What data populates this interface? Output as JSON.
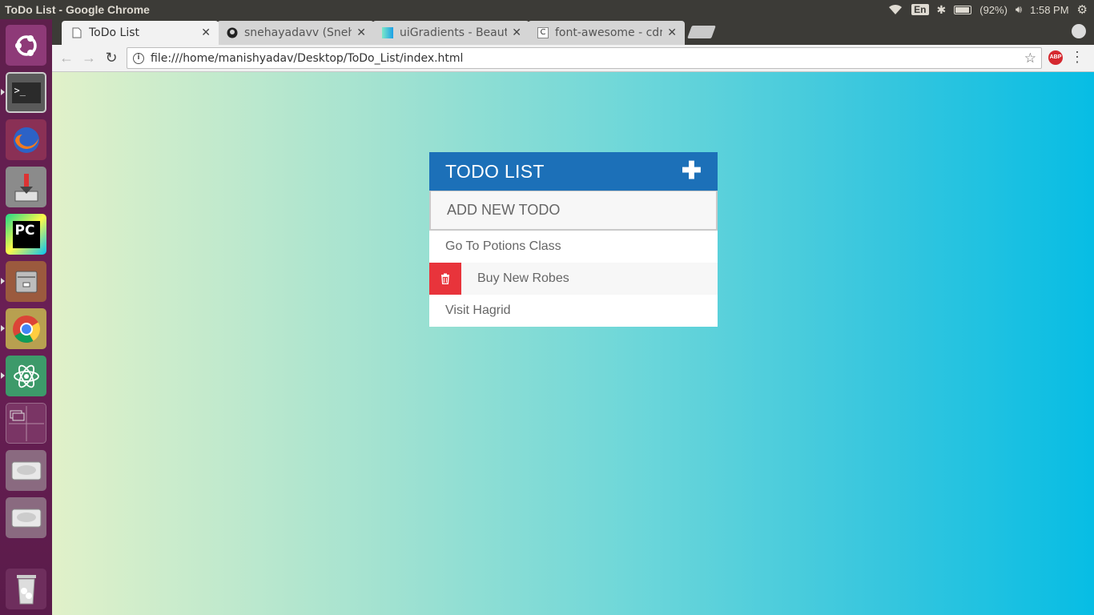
{
  "system_panel": {
    "window_title": "ToDo List - Google Chrome",
    "keyboard_layout": "En",
    "battery": "(92%)",
    "time": "1:58 PM"
  },
  "launcher": {
    "items": [
      "ubuntu-dash-icon",
      "terminal-icon",
      "firefox-icon",
      "installer-icon",
      "pycharm-icon",
      "file-manager-icon",
      "chrome-icon",
      "atom-icon",
      "workspace-switcher-icon",
      "drive-icon",
      "drive-icon",
      "trash-icon"
    ]
  },
  "browser": {
    "tabs": [
      {
        "title": "ToDo List",
        "active": true
      },
      {
        "title": "snehayadavv (Sneh",
        "active": false
      },
      {
        "title": "uiGradients - Beaut",
        "active": false
      },
      {
        "title": "font-awesome - cdn",
        "active": false
      }
    ],
    "url": "file:///home/manishyadav/Desktop/ToDo_List/index.html",
    "extension_badge": "ABP"
  },
  "app": {
    "title": "TODO LIST",
    "add_placeholder": "ADD NEW TODO",
    "todos": [
      {
        "text": "Go To Potions Class",
        "hovered": false
      },
      {
        "text": "Buy New Robes",
        "hovered": true
      },
      {
        "text": "Visit Hagrid",
        "hovered": false
      }
    ],
    "colors": {
      "header": "#1c70b8",
      "delete": "#e8343b",
      "gradient_start": "#e1f1c9",
      "gradient_end": "#07bde4"
    }
  }
}
